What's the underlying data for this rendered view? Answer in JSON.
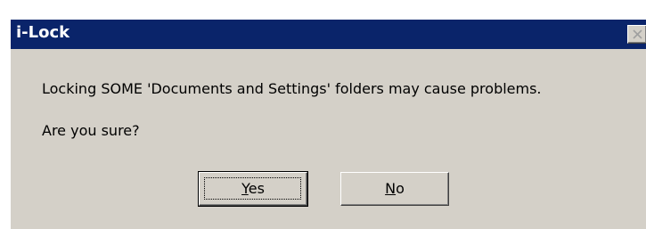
{
  "dialog": {
    "title": "i-Lock",
    "message_line1": "Locking SOME 'Documents and Settings' folders  may cause problems.",
    "message_line2": "Are you sure?"
  },
  "buttons": {
    "yes": {
      "accel": "Y",
      "rest": "es"
    },
    "no": {
      "accel": "N",
      "rest": "o"
    }
  },
  "icons": {
    "close": "close-icon"
  },
  "colors": {
    "titlebar": "#0a246a",
    "face": "#d4d0c8"
  }
}
